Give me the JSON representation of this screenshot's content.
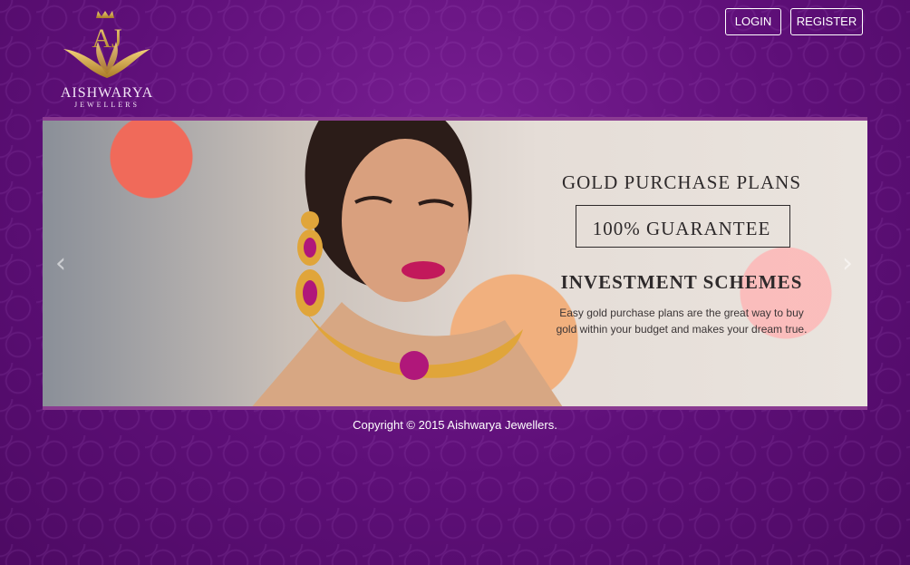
{
  "brand": {
    "name": "AISHWARYA",
    "subtitle": "JEWELLERS",
    "logo": "lotus-crown-logo"
  },
  "nav": {
    "login_label": "LOGIN",
    "register_label": "REGISTER"
  },
  "slider": {
    "title": "GOLD PURCHASE PLANS",
    "badge": "100% GUARANTEE",
    "subtitle": "INVESTMENT SCHEMES",
    "description_line1": "Easy gold purchase plans are the great way to buy",
    "description_line2": "gold within your budget and makes your dream true.",
    "prev_icon": "chevron-left-icon",
    "next_icon": "chevron-right-icon"
  },
  "footer": {
    "copyright": "Copyright © 2015 Aishwarya Jewellers."
  },
  "colors": {
    "background": "#5e0f78",
    "slider_border": "#8a3b91",
    "logo_gold": "#c9a24a"
  }
}
